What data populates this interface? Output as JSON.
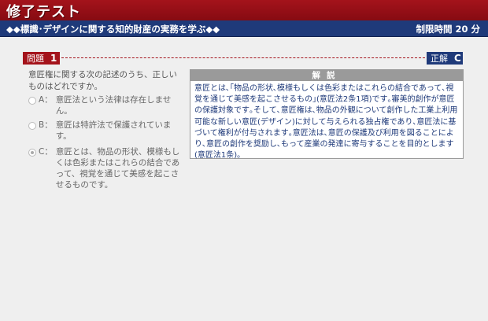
{
  "header": {
    "title": "修了テスト"
  },
  "topic_bar": {
    "topic": "◆◆標識･デザインに関する知的財産の実務を学ぶ◆◆",
    "time_limit": "制限時間 20 分"
  },
  "question": {
    "label": "問題",
    "number": "1",
    "text": "意匠権に関する次の記述のうち、正しいものはどれですか。"
  },
  "answer": {
    "label": "正解",
    "value": "C"
  },
  "choices": [
    {
      "key": "A：",
      "text": "意匠法という法律は存在しません。",
      "selected": false
    },
    {
      "key": "B：",
      "text": "意匠は特許法で保護されています。",
      "selected": false
    },
    {
      "key": "C：",
      "text": "意匠とは、物品の形状、模様もしくは色彩またはこれらの結合であって、視覚を通じて美感を起こさせるものです。",
      "selected": true
    }
  ],
  "explanation": {
    "title": "解説",
    "body": "意匠とは､｢物品の形状､模様もしくは色彩またはこれらの結合であって､視覚を通じて美感を起こさせるもの｣(意匠法2条1項)です｡審美的創作が意匠の保護対象です｡そして､意匠権は､物品の外観について創作した工業上利用可能な新しい意匠(デザイン)に対して与えられる独占権であり､意匠法に基づいて権利が付与されます｡意匠法は､意匠の保護及び利用を図ることにより､意匠の創作を奨励し､もって産業の発達に寄与することを目的とします(意匠法1条)｡"
  }
}
